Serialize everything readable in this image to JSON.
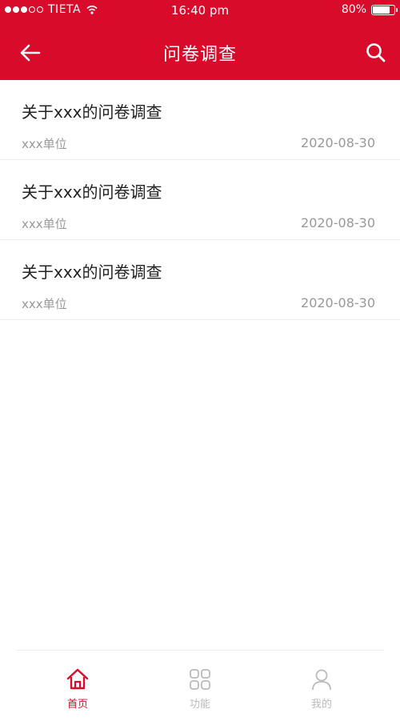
{
  "status_bar": {
    "carrier": "TIETA",
    "time": "16:40 pm",
    "battery": "80%",
    "battery_level": 0.8
  },
  "nav": {
    "title": "问卷调查",
    "back_icon": "arrow-left-icon",
    "search_icon": "search-icon"
  },
  "items": [
    {
      "title": "关于xxx的问卷调查",
      "unit": "xxx单位",
      "date": "2020-08-30"
    },
    {
      "title": "关于xxx的问卷调查",
      "unit": "xxx单位",
      "date": "2020-08-30"
    },
    {
      "title": "关于xxx的问卷调查",
      "unit": "xxx单位",
      "date": "2020-08-30"
    }
  ],
  "tabs": [
    {
      "label": "首页",
      "icon": "home-icon",
      "active": true
    },
    {
      "label": "功能",
      "icon": "grid-icon",
      "active": false
    },
    {
      "label": "我的",
      "icon": "user-icon",
      "active": false
    }
  ],
  "colors": {
    "brand": "#d80c2a",
    "inactive": "#bbbbbb",
    "text_primary": "#222222",
    "text_secondary": "#999999"
  }
}
